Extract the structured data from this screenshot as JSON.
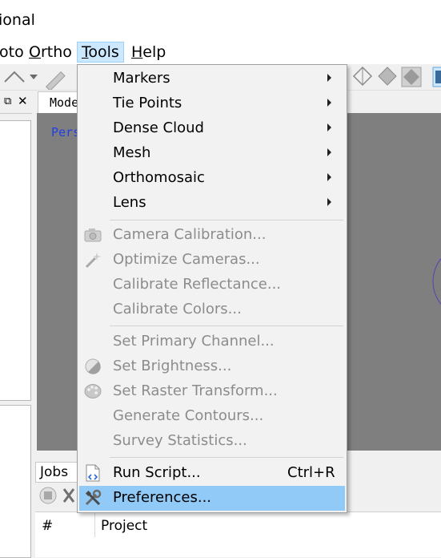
{
  "window": {
    "title_fragment": "ional"
  },
  "menubar": {
    "items": [
      {
        "label": "oto"
      },
      {
        "label": "Ortho"
      },
      {
        "label": "Tools"
      },
      {
        "label": "Help"
      }
    ]
  },
  "panel_tabs": {
    "model": "Mode"
  },
  "viewport": {
    "perspective_label": "Pers"
  },
  "jobs": {
    "tab_label": "Jobs",
    "columns": [
      "#",
      "Project"
    ]
  },
  "tools_menu": {
    "items": [
      {
        "label": "Markers",
        "submenu": true,
        "enabled": true
      },
      {
        "label": "Tie Points",
        "submenu": true,
        "enabled": true
      },
      {
        "label": "Dense Cloud",
        "submenu": true,
        "enabled": true
      },
      {
        "label": "Mesh",
        "submenu": true,
        "enabled": true
      },
      {
        "label": "Orthomosaic",
        "submenu": true,
        "enabled": true
      },
      {
        "label": "Lens",
        "submenu": true,
        "enabled": true
      },
      {
        "label": "Camera Calibration...",
        "enabled": false,
        "icon": "camera-icon"
      },
      {
        "label": "Optimize Cameras...",
        "enabled": false,
        "icon": "magic-wand-icon"
      },
      {
        "label": "Calibrate Reflectance...",
        "enabled": false
      },
      {
        "label": "Calibrate Colors...",
        "enabled": false
      },
      {
        "label": "Set Primary Channel...",
        "enabled": false
      },
      {
        "label": "Set Brightness...",
        "enabled": false,
        "icon": "brightness-icon"
      },
      {
        "label": "Set Raster Transform...",
        "enabled": false,
        "icon": "palette-icon"
      },
      {
        "label": "Generate Contours...",
        "enabled": false
      },
      {
        "label": "Survey Statistics...",
        "enabled": false
      },
      {
        "label": "Run Script...",
        "enabled": true,
        "shortcut": "Ctrl+R",
        "icon": "script-icon"
      },
      {
        "label": "Preferences...",
        "enabled": true,
        "highlighted": true,
        "icon": "tools-icon"
      }
    ]
  },
  "colors": {
    "highlight": "#91c9f7",
    "viewport_bg": "#7f7f7f",
    "perspective_text": "#1f3fe6",
    "disabled_text": "#8c8c8c"
  }
}
